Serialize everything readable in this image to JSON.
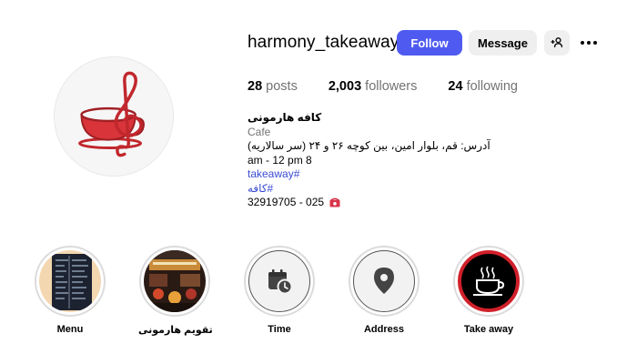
{
  "profile": {
    "username": "harmony_takeaway",
    "avatar_icon": "teacup-treble-clef-logo",
    "brand_color": "#c1272d"
  },
  "actions": {
    "follow_label": "Follow",
    "message_label": "Message",
    "add_user_icon": "add-user-icon",
    "more_icon": "more-horizontal-icon",
    "follow_color": "#4f5bf0"
  },
  "stats": {
    "posts_count": "28",
    "posts_label": "posts",
    "followers_count": "2,003",
    "followers_label": "followers",
    "following_count": "24",
    "following_label": "following"
  },
  "bio": {
    "name": "کافه هارمونی",
    "category": "Cafe",
    "address": "آدرس: قم، بلوار امین، بین کوچه ۲۶ و ۲۴ (سر سالاریه)",
    "hours": "am - 12 pm 8",
    "tag_1": "takeaway#",
    "tag_2": "کافه#",
    "phone": "32919705 - 025",
    "phone_icon": "telephone-icon"
  },
  "highlights": [
    {
      "label": "Menu",
      "icon": "menu-photo"
    },
    {
      "label": "تقویم هارمونی",
      "icon": "cafe-interior-photo"
    },
    {
      "label": "Time",
      "icon": "calendar-clock-icon"
    },
    {
      "label": "Address",
      "icon": "location-pin-icon"
    },
    {
      "label": "Take away",
      "icon": "coffee-cup-icon"
    }
  ]
}
